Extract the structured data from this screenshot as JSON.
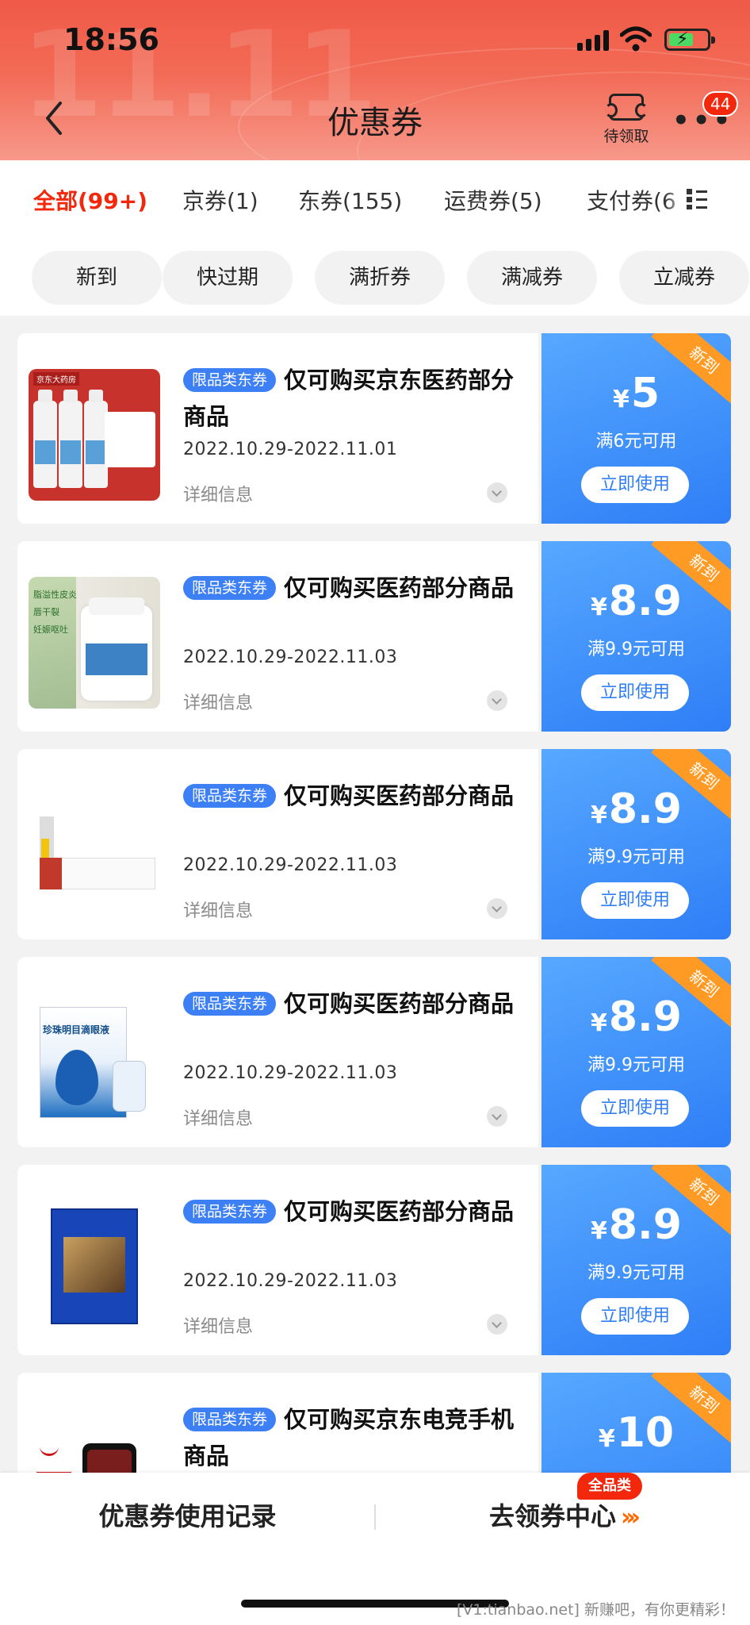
{
  "status_bar": {
    "time": "18:56"
  },
  "header": {
    "title": "优惠券",
    "pending_label": "待领取",
    "notification_count": "44"
  },
  "tabs": [
    {
      "label": "全部(99+)",
      "active": true
    },
    {
      "label": "京券(1)"
    },
    {
      "label": "东券(155)"
    },
    {
      "label": "运费券(5)"
    },
    {
      "label": "支付券(6"
    }
  ],
  "filters": [
    "新到",
    "快过期",
    "满折券",
    "满减券",
    "立减券"
  ],
  "coupons": [
    {
      "tag": "限品类东券",
      "title": "仅可购买京东医药部分商品",
      "date": "2022.10.29-2022.11.01",
      "detail": "详细信息",
      "currency": "¥",
      "amount": "5",
      "condition": "满6元可用",
      "button": "立即使用",
      "ribbon": "新到"
    },
    {
      "tag": "限品类东券",
      "title": "仅可购买医药部分商品",
      "date": "2022.10.29-2022.11.03",
      "detail": "详细信息",
      "currency": "¥",
      "amount": "8.9",
      "condition": "满9.9元可用",
      "button": "立即使用",
      "ribbon": "新到"
    },
    {
      "tag": "限品类东券",
      "title": "仅可购买医药部分商品",
      "date": "2022.10.29-2022.11.03",
      "detail": "详细信息",
      "currency": "¥",
      "amount": "8.9",
      "condition": "满9.9元可用",
      "button": "立即使用",
      "ribbon": "新到"
    },
    {
      "tag": "限品类东券",
      "title": "仅可购买医药部分商品",
      "date": "2022.10.29-2022.11.03",
      "detail": "详细信息",
      "currency": "¥",
      "amount": "8.9",
      "condition": "满9.9元可用",
      "button": "立即使用",
      "ribbon": "新到"
    },
    {
      "tag": "限品类东券",
      "title": "仅可购买医药部分商品",
      "date": "2022.10.29-2022.11.03",
      "detail": "详细信息",
      "currency": "¥",
      "amount": "8.9",
      "condition": "满9.9元可用",
      "button": "立即使用",
      "ribbon": "新到"
    },
    {
      "tag": "限品类东券",
      "title": "仅可购买京东电竞手机商品",
      "date": "",
      "detail": "",
      "currency": "¥",
      "amount": "10",
      "condition": "",
      "button": "",
      "ribbon": "新到"
    }
  ],
  "product_texts": {
    "p1_brand": "京东大药房",
    "p2_lines": [
      "脂溢性皮炎",
      "唇干裂",
      "妊娠呕吐"
    ],
    "p4_name": "珍珠明目滴眼液"
  },
  "bottom_bar": {
    "records_label": "优惠券使用记录",
    "center_label": "去领券中心",
    "center_arrows": "›››",
    "center_badge": "全品类"
  },
  "watermark": "[V1:tianbao.net] 新赚吧，有你更精彩！",
  "colors": {
    "accent": "#f2270c",
    "coupon_blue": "#2f7ef7",
    "ribbon_orange": "#ff9b25"
  }
}
